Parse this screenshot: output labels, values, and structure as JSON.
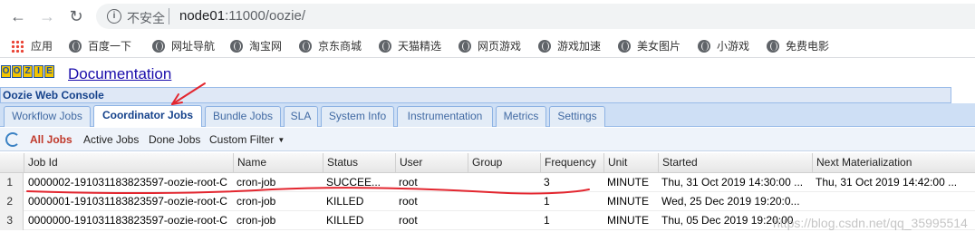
{
  "browser": {
    "security_label": "不安全",
    "url_host": "node01",
    "url_rest": ":11000/oozie/",
    "bookmarks": [
      {
        "label": "应用",
        "icon": "apps-grid-icon"
      },
      {
        "label": "百度一下",
        "icon": "globe-icon"
      },
      {
        "label": "网址导航",
        "icon": "globe-icon"
      },
      {
        "label": "淘宝网",
        "icon": "globe-icon"
      },
      {
        "label": "京东商城",
        "icon": "globe-icon"
      },
      {
        "label": "天猫精选",
        "icon": "globe-icon"
      },
      {
        "label": "网页游戏",
        "icon": "globe-icon"
      },
      {
        "label": "游戏加速",
        "icon": "globe-icon"
      },
      {
        "label": "美女图片",
        "icon": "globe-icon"
      },
      {
        "label": "小游戏",
        "icon": "globe-icon"
      },
      {
        "label": "免费电影",
        "icon": "globe-icon"
      }
    ]
  },
  "header": {
    "logo_letters": [
      "O",
      "O",
      "Z",
      "I",
      "E"
    ],
    "documentation_link": "Documentation",
    "console_title": "Oozie Web Console"
  },
  "tabs": [
    {
      "label": "Workflow Jobs",
      "active": false
    },
    {
      "label": "Coordinator Jobs",
      "active": true
    },
    {
      "label": "Bundle Jobs",
      "active": false
    },
    {
      "label": "SLA",
      "active": false
    },
    {
      "label": "System Info",
      "active": false
    },
    {
      "label": "Instrumentation",
      "active": false
    },
    {
      "label": "Metrics",
      "active": false
    },
    {
      "label": "Settings",
      "active": false
    }
  ],
  "toolbar": {
    "all_jobs": "All Jobs",
    "active_jobs": "Active Jobs",
    "done_jobs": "Done Jobs",
    "custom_filter": "Custom Filter"
  },
  "grid": {
    "columns": [
      "Job Id",
      "Name",
      "Status",
      "User",
      "Group",
      "Frequency",
      "Unit",
      "Started",
      "Next Materialization"
    ],
    "rows": [
      {
        "num": "1",
        "job_id": "0000002-191031183823597-oozie-root-C",
        "name": "cron-job",
        "status": "SUCCEE...",
        "user": "root",
        "group": "",
        "frequency": "3",
        "unit": "MINUTE",
        "started": "Thu, 31 Oct 2019 14:30:00 ...",
        "next": "Thu, 31 Oct 2019 14:42:00 ..."
      },
      {
        "num": "2",
        "job_id": "0000001-191031183823597-oozie-root-C",
        "name": "cron-job",
        "status": "KILLED",
        "user": "root",
        "group": "",
        "frequency": "1",
        "unit": "MINUTE",
        "started": "Wed, 25 Dec 2019 19:20:0...",
        "next": ""
      },
      {
        "num": "3",
        "job_id": "0000000-191031183823597-oozie-root-C",
        "name": "cron-job",
        "status": "KILLED",
        "user": "root",
        "group": "",
        "frequency": "1",
        "unit": "MINUTE",
        "started": "Thu, 05 Dec 2019 19:20:00",
        "next": ""
      }
    ]
  },
  "watermark": "https://blog.csdn.net/qq_35995514",
  "colors": {
    "annotation_red": "#e3262f",
    "active_tab_text": "#15428b",
    "all_jobs_text": "#c0392b"
  }
}
